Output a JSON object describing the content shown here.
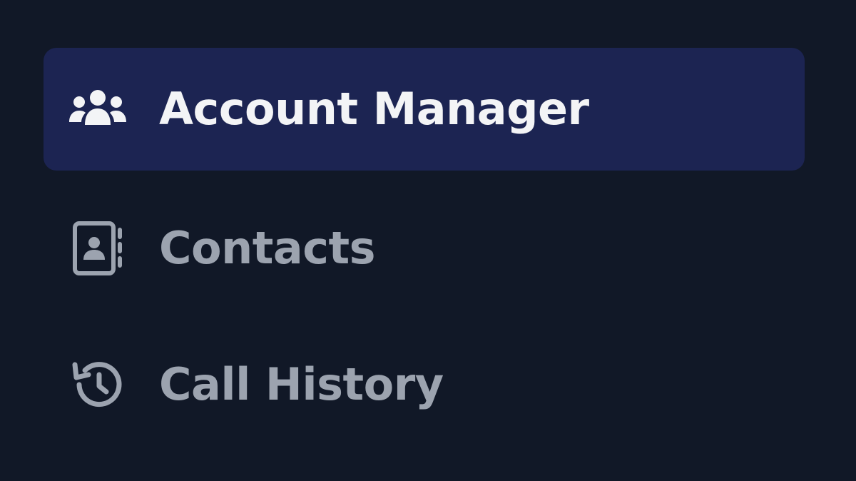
{
  "sidebar": {
    "items": [
      {
        "label": "Account Manager",
        "icon": "users-icon",
        "active": true
      },
      {
        "label": "Contacts",
        "icon": "address-book-icon",
        "active": false
      },
      {
        "label": "Call History",
        "icon": "history-icon",
        "active": false
      }
    ]
  },
  "colors": {
    "background": "#111827",
    "active_bg": "#1c2452",
    "active_text": "#f3f4f6",
    "inactive_text": "#9ca3af"
  }
}
